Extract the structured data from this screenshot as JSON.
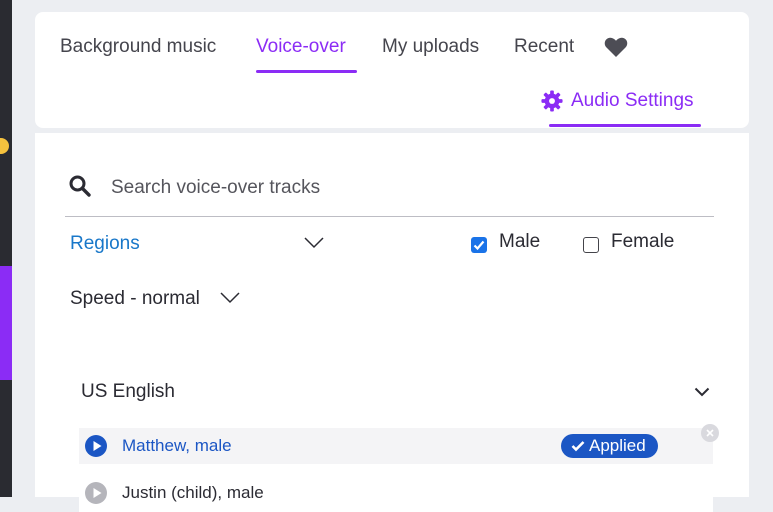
{
  "tabs": [
    {
      "label": "Background music",
      "active": false
    },
    {
      "label": "Voice-over",
      "active": true
    },
    {
      "label": "My uploads",
      "active": false
    },
    {
      "label": "Recent",
      "active": false
    }
  ],
  "favorites_icon": "heart-icon",
  "audio_settings": {
    "label": "Audio Settings",
    "icon": "gear-icon"
  },
  "search": {
    "placeholder": "Search voice-over tracks",
    "value": ""
  },
  "filters": {
    "regions_label": "Regions",
    "male": {
      "label": "Male",
      "checked": true
    },
    "female": {
      "label": "Female",
      "checked": false
    },
    "speed_label": "Speed - normal"
  },
  "language_group": {
    "label": "US English"
  },
  "tracks": [
    {
      "name": "Matthew, male",
      "status": "Applied"
    },
    {
      "name": "Justin (child), male"
    }
  ],
  "colors": {
    "accent": "#8b2cf5",
    "link": "#1877c9",
    "applied_badge": "#1b56c4"
  }
}
